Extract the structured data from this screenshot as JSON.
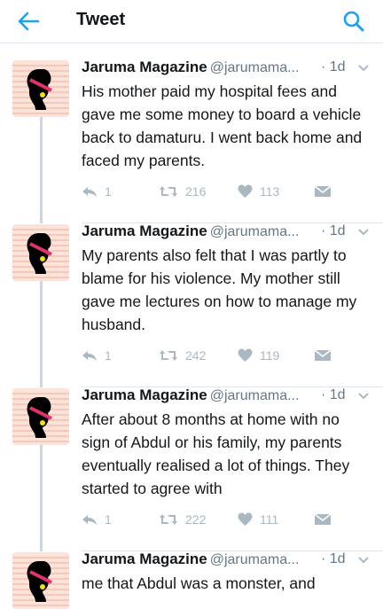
{
  "header": {
    "title": "Tweet"
  },
  "tweets": [
    {
      "name": "Jaruma Magazine",
      "handle": "@jarumama...",
      "time": "· 1d",
      "text": "His mother paid my hospital fees and gave me some money to board a vehicle back to damaturu. I went back home and faced my parents.",
      "replies": "1",
      "retweets": "216",
      "likes": "113"
    },
    {
      "name": "Jaruma Magazine",
      "handle": "@jarumama...",
      "time": "· 1d",
      "text": "My parents also felt that I was partly to blame for his violence. My mother still gave me lectures on how to manage my husband.",
      "replies": "1",
      "retweets": "242",
      "likes": "119"
    },
    {
      "name": "Jaruma Magazine",
      "handle": "@jarumama...",
      "time": "· 1d",
      "text": "After about 8 months at home with no sign of Abdul or his family, my parents eventually realised a lot of things. They started to agree with",
      "replies": "1",
      "retweets": "222",
      "likes": "111"
    },
    {
      "name": "Jaruma Magazine",
      "handle": "@jarumama...",
      "time": "· 1d",
      "text": "me that Abdul was a monster, and"
    }
  ],
  "colors": {
    "accent": "#1da1f2",
    "icon_gray": "#aab8c2",
    "avatar_stripes": "#f6c8b8",
    "avatar_sash": "#e0336e",
    "avatar_gem": "#f4e300"
  },
  "icons": {
    "back": "arrow-left-icon",
    "search": "search-icon",
    "caret": "chevron-down-icon",
    "reply": "reply-icon",
    "retweet": "retweet-icon",
    "like": "heart-icon",
    "dm": "envelope-icon"
  }
}
